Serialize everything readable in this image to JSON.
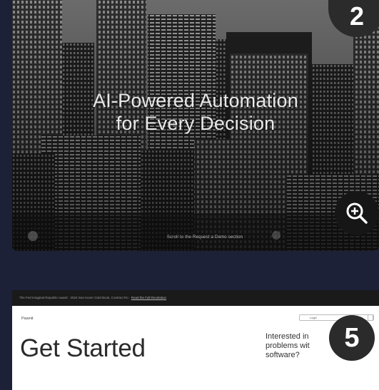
{
  "hero": {
    "title_line1": "AI-Powered Automation",
    "title_line2": "for Every Decision",
    "caption": "Scroll to the Request a Demo section",
    "badge_number": "2",
    "zoom_icon": "zoom-in-icon"
  },
  "strip": {
    "text": "The Fed Imaginal Republic Award · 2024 Sea Hover Gold Book, Contract Ro ·",
    "link": "Read the Fall Revelation"
  },
  "get_started": {
    "brand": "Pawnit",
    "heading": "Get Started",
    "nav_button": "Login",
    "interest_line1": "Interested in",
    "interest_line2": "problems wit",
    "interest_line3": "software?",
    "badge_number": "5"
  },
  "colors": {
    "background": "#1c2138",
    "badge": "#2b2b2b",
    "zoom_button": "#161616"
  }
}
